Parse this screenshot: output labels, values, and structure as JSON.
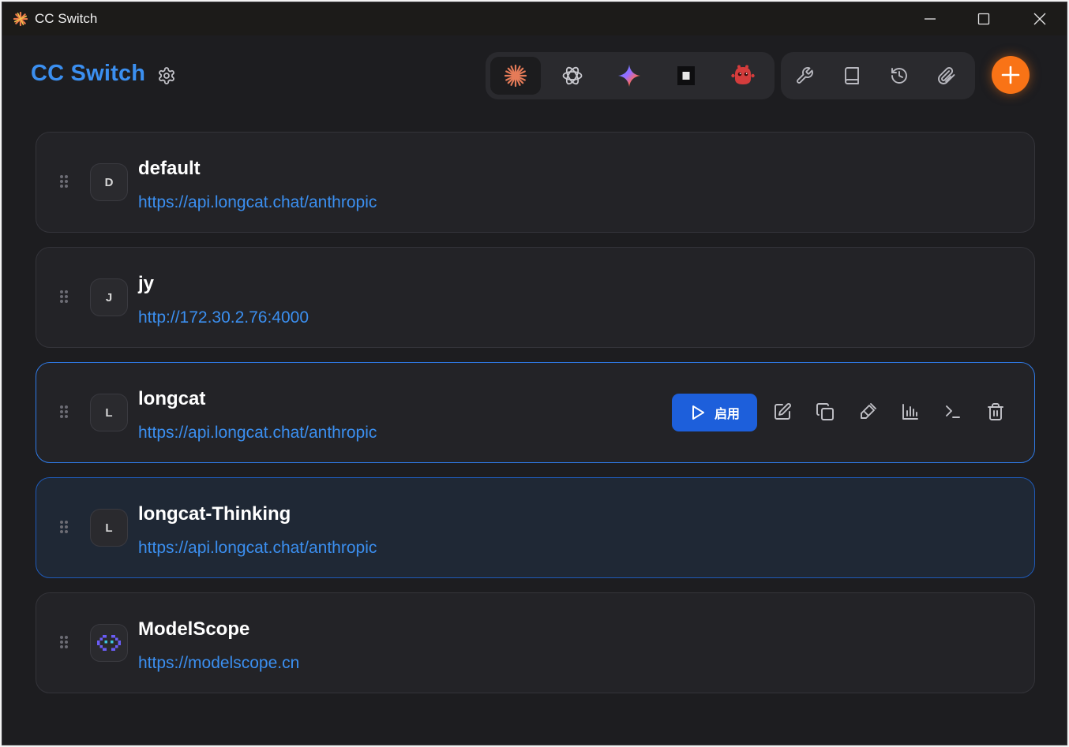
{
  "window": {
    "title": "CC Switch",
    "controls": [
      "minimize",
      "maximize",
      "close"
    ]
  },
  "header": {
    "brand": "CC Switch",
    "settings_icon": "gear-icon",
    "app_tabs": [
      {
        "name": "claude",
        "icon": "claude-asterisk-icon",
        "active": true
      },
      {
        "name": "openai",
        "icon": "openai-knot-icon",
        "active": false
      },
      {
        "name": "gemini",
        "icon": "gemini-star-icon",
        "active": false
      },
      {
        "name": "terminal",
        "icon": "square-terminal-icon",
        "active": false
      },
      {
        "name": "bot",
        "icon": "red-bot-icon",
        "active": false
      }
    ],
    "tools": [
      {
        "name": "config",
        "icon": "wrench-icon"
      },
      {
        "name": "docs",
        "icon": "book-icon"
      },
      {
        "name": "history",
        "icon": "history-icon"
      },
      {
        "name": "attach",
        "icon": "paperclip-icon"
      }
    ],
    "add_icon": "plus-icon",
    "accent_color": "#f97316",
    "brand_color": "#3b8ff0"
  },
  "providers": [
    {
      "name": "default",
      "avatar": "D",
      "url": "https://api.longcat.chat/anthropic",
      "state": "normal"
    },
    {
      "name": "jy",
      "avatar": "J",
      "url": "http://172.30.2.76:4000",
      "state": "normal"
    },
    {
      "name": "longcat",
      "avatar": "L",
      "url": "https://api.longcat.chat/anthropic",
      "state": "hover"
    },
    {
      "name": "longcat-Thinking",
      "avatar": "L",
      "url": "https://api.longcat.chat/anthropic",
      "state": "current"
    },
    {
      "name": "ModelScope",
      "avatar": "",
      "avatar_icon": "modelscope-logo-icon",
      "url": "https://modelscope.cn",
      "state": "normal"
    }
  ],
  "row_actions": {
    "enable_label": "启用",
    "enable_color": "#1d5fdb",
    "icons": [
      "edit-icon",
      "duplicate-icon",
      "test-icon",
      "usage-chart-icon",
      "terminal-icon",
      "trash-icon"
    ]
  }
}
